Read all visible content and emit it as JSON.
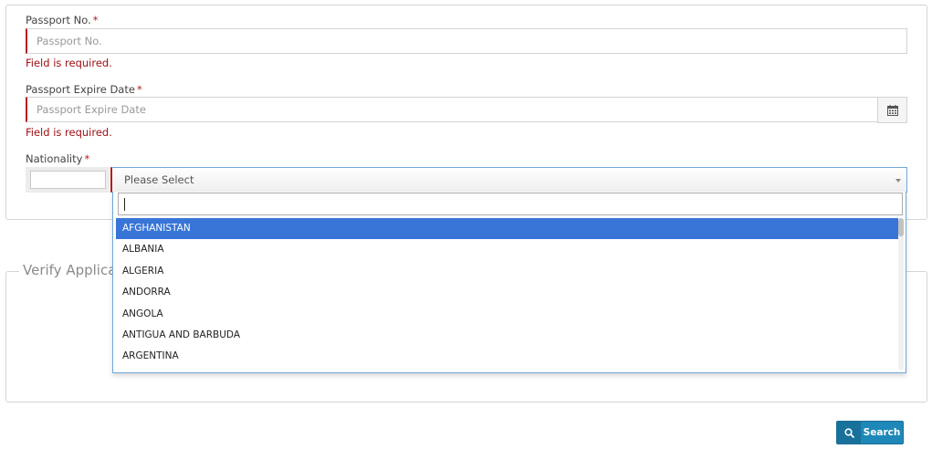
{
  "passport": {
    "label": "Passport No.",
    "required_mark": "*",
    "placeholder": "Passport No.",
    "error": "Field is required."
  },
  "expiry": {
    "label": "Passport Expire Date",
    "required_mark": "*",
    "placeholder": "Passport Expire Date",
    "error": "Field is required.",
    "icon": "calendar-icon"
  },
  "nationality": {
    "label": "Nationality",
    "required_mark": "*",
    "selected": "Please Select",
    "search_value": "",
    "options": [
      "AFGHANISTAN",
      "ALBANIA",
      "ALGERIA",
      "ANDORRA",
      "ANGOLA",
      "ANTIGUA AND BARBUDA",
      "ARGENTINA"
    ],
    "highlighted_option": "AFGHANISTAN"
  },
  "verify": {
    "legend": "Verify Applica"
  },
  "search_button": {
    "label": "Search",
    "icon": "search-icon"
  },
  "colors": {
    "error": "#a00f14",
    "required_border": "#b71c1c",
    "highlight": "#3875d7",
    "button": "#1e88b8"
  }
}
